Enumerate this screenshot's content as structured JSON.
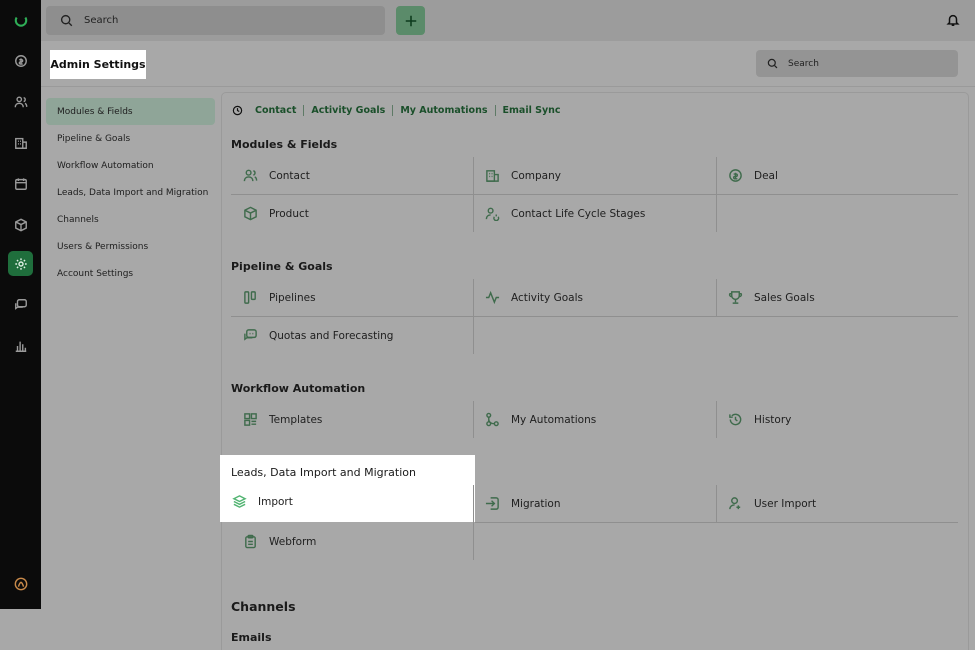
{
  "topbar": {
    "search_placeholder": "Search"
  },
  "header": {
    "title": "Admin Settings",
    "search_placeholder": "Search"
  },
  "sidebar": {
    "items": [
      {
        "label": "Modules & Fields",
        "active": true
      },
      {
        "label": "Pipeline & Goals"
      },
      {
        "label": "Workflow Automation"
      },
      {
        "label": "Leads, Data Import and Migration"
      },
      {
        "label": "Channels"
      },
      {
        "label": "Users & Permissions"
      },
      {
        "label": "Account Settings"
      }
    ]
  },
  "quicklinks": [
    "Contact",
    "Activity Goals",
    "My Automations",
    "Email Sync"
  ],
  "sections": {
    "modules": {
      "title": "Modules & Fields",
      "items": [
        "Contact",
        "Company",
        "Deal",
        "Product",
        "Contact Life Cycle Stages"
      ]
    },
    "pipeline": {
      "title": "Pipeline & Goals",
      "items": [
        "Pipelines",
        "Activity Goals",
        "Sales Goals",
        "Quotas and Forecasting"
      ]
    },
    "workflow": {
      "title": "Workflow Automation",
      "items": [
        "Templates",
        "My Automations",
        "History"
      ]
    },
    "leads": {
      "title": "Leads, Data Import and Migration",
      "items": [
        "Import",
        "Migration",
        "User Import",
        "Webform"
      ]
    },
    "channels": {
      "title": "Channels",
      "subtitle": "Emails"
    }
  },
  "colors": {
    "accent": "#1f6e3c",
    "icon_green": "#3f6b4c",
    "overlay_gray": "#a8a8a8"
  }
}
